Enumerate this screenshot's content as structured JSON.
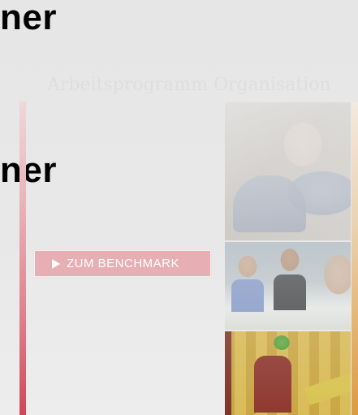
{
  "overlay_text": {
    "word_top": "ner",
    "word_middle": "ner"
  },
  "page": {
    "title": "Arbeitsprogramm Organisation"
  },
  "cta": {
    "label": "ZUM BENCHMARK",
    "icon": "play-triangle-icon"
  },
  "photos": [
    {
      "name": "person-on-phone-photo"
    },
    {
      "name": "office-team-photo"
    },
    {
      "name": "factory-worker-photo"
    }
  ],
  "colors": {
    "accent_red": "#cf4758",
    "button_bg": "#e7aeb4",
    "accent_orange": "#dd9a3f"
  }
}
